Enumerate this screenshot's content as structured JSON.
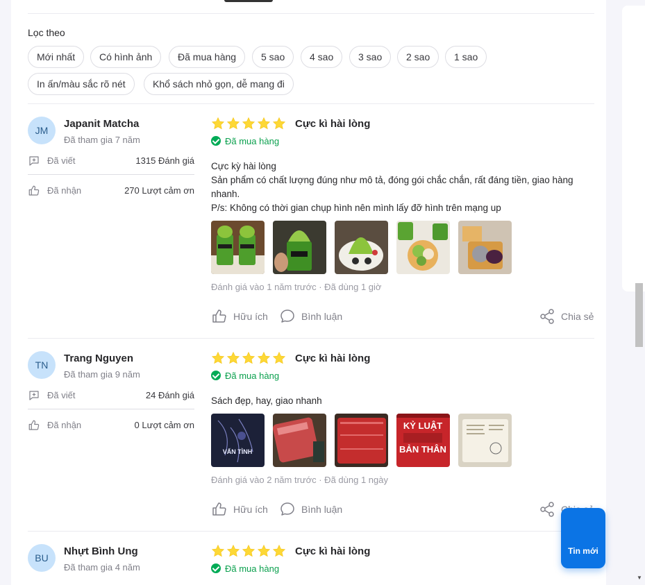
{
  "filter": {
    "title": "Lọc theo",
    "chips": [
      "Mới nhất",
      "Có hình ảnh",
      "Đã mua hàng",
      "5 sao",
      "4 sao",
      "3 sao",
      "2 sao",
      "1 sao",
      "In ấn/màu sắc rõ nét",
      "Khổ sách nhỏ gọn, dễ mang đi"
    ]
  },
  "labels": {
    "written": "Đã viết",
    "received": "Đã nhận",
    "verified": "Đã mua hàng",
    "helpful": "Hữu ích",
    "comment": "Bình luận",
    "share": "Chia sẻ",
    "share_partial": "Chia sẻ"
  },
  "colors": {
    "accent": "#0b74e5",
    "star": "#fdd836",
    "verified": "#0ba04e",
    "avatar_bg": "#c7e2fb"
  },
  "reviews": [
    {
      "initials": "JM",
      "name": "Japanit Matcha",
      "joined": "Đã tham gia 7 năm",
      "written": "1315 Đánh giá",
      "received": "270 Lượt cảm ơn",
      "rating": 5,
      "title": "Cực kì hài lòng",
      "text_lines": [
        "Cực kỳ hài lòng",
        "Sản phẩm có chất lượng đúng như mô tả, đóng gói chắc chắn, rất đáng tiền, giao hàng",
        "nhanh.",
        "P/s: Không có thời gian chụp hình nên mình lấy đỡ hình trên mạng up"
      ],
      "meta": "Đánh giá vào 1 năm trước · Đã dùng 1 giờ"
    },
    {
      "initials": "TN",
      "name": "Trang Nguyen",
      "joined": "Đã tham gia 9 năm",
      "written": "24 Đánh giá",
      "received": "0 Lượt cảm ơn",
      "rating": 5,
      "title": "Cực kì hài lòng",
      "text_lines": [
        "Sách đẹp, hay, giao nhanh"
      ],
      "meta": "Đánh giá vào 2 năm trước · Đã dùng 1 ngày",
      "photo_texts": [
        "VẤN TÌNH",
        "KỶ LUẬT BẢN THÂN"
      ]
    },
    {
      "initials": "BU",
      "name": "Nhựt Bình Ung",
      "joined": "Đã tham gia 4 năm",
      "rating": 5,
      "title": "Cực kì hài lòng"
    }
  ],
  "floating": {
    "new_label": "Tin mới"
  }
}
